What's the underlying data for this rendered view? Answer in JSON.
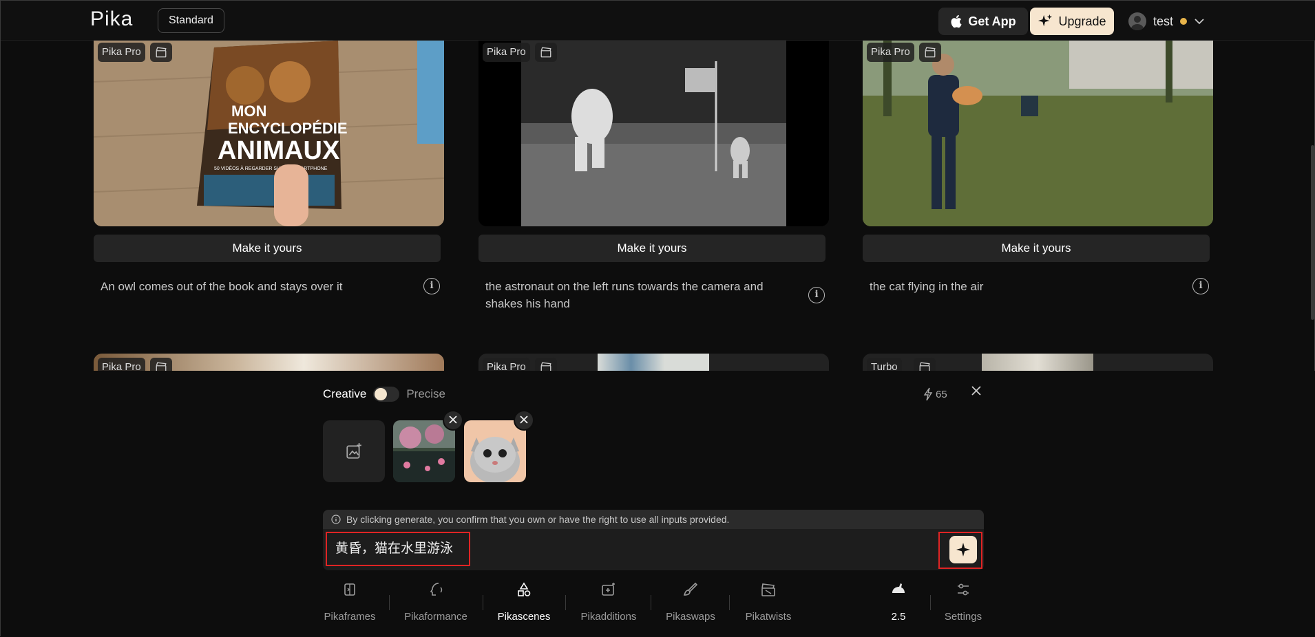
{
  "header": {
    "logo": "Pika",
    "plan": "Standard",
    "get_app": "Get App",
    "upgrade": "Upgrade",
    "username": "test"
  },
  "gallery": {
    "make_it_yours": "Make it yours",
    "cards": [
      {
        "tag": "Pika Pro",
        "prompt": "An owl comes out of the book and stays over it"
      },
      {
        "tag": "Pika Pro",
        "prompt": "the astronaut on the left runs towards the camera and shakes his hand"
      },
      {
        "tag": "Pika Pro",
        "prompt": "the cat flying in the air"
      },
      {
        "tag": "Pika Pro"
      },
      {
        "tag": "Pika Pro"
      },
      {
        "tag": "Turbo"
      }
    ],
    "book_title_1": "MON",
    "book_title_2": "ENCYCLOPÉDIE",
    "book_title_3": "ANIMAUX",
    "book_subtitle": "50 VIDÉOS À REGARDER SUR UN SMARTPHONE"
  },
  "panel": {
    "mode_creative": "Creative",
    "mode_precise": "Precise",
    "credits": "65",
    "notice": "By clicking generate, you confirm that you own or have the right to use all inputs provided.",
    "prompt_value": "黄昏，猫在水里游泳",
    "tools": [
      {
        "label": "Pikaframes"
      },
      {
        "label": "Pikaformance"
      },
      {
        "label": "Pikascenes"
      },
      {
        "label": "Pikadditions"
      },
      {
        "label": "Pikaswaps"
      },
      {
        "label": "Pikatwists"
      },
      {
        "label": "2.5"
      },
      {
        "label": "Settings"
      }
    ]
  },
  "colors": {
    "accent": "#f7e6cf",
    "highlight": "#e02424",
    "background": "#0d0d0d"
  }
}
